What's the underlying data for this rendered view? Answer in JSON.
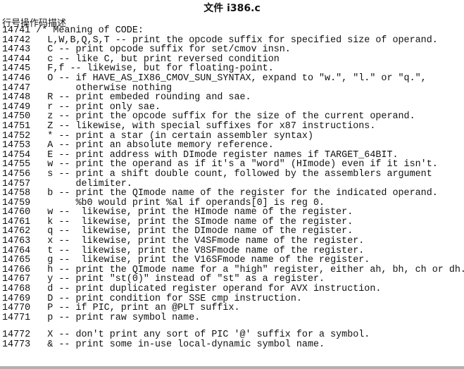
{
  "title": "文件 i386.c",
  "header": "行号操作码描述",
  "lines": [
    {
      "num": "14741",
      "text": "/* Meaning of CODE:"
    },
    {
      "num": "14742",
      "text": "  L,W,B,Q,S,T -- print the opcode suffix for specified size of operand."
    },
    {
      "num": "14743",
      "text": "  C -- print opcode suffix for set/cmov insn."
    },
    {
      "num": "14744",
      "text": "  c -- like C, but print reversed condition"
    },
    {
      "num": "14745",
      "text": "  F,f -- likewise, but for floating-point."
    },
    {
      "num": "14746",
      "text": "  O -- if HAVE_AS_IX86_CMOV_SUN_SYNTAX, expand to \"w.\", \"l.\" or \"q.\","
    },
    {
      "num": "14747",
      "text": "       otherwise nothing"
    },
    {
      "num": "14748",
      "text": "  R -- print embeded rounding and sae."
    },
    {
      "num": "14749",
      "text": "  r -- print only sae."
    },
    {
      "num": "14750",
      "text": "  z -- print the opcode suffix for the size of the current operand."
    },
    {
      "num": "14751",
      "text": "  Z -- likewise, with special suffixes for x87 instructions."
    },
    {
      "num": "14752",
      "text": "  * -- print a star (in certain assembler syntax)"
    },
    {
      "num": "14753",
      "text": "  A -- print an absolute memory reference."
    },
    {
      "num": "14754",
      "text": "  E -- print address with DImode register names if TARGET_64BIT."
    },
    {
      "num": "14755",
      "text": "  w -- print the operand as if it's a \"word\" (HImode) even if it isn't."
    },
    {
      "num": "14756",
      "text": "  s -- print a shift double count, followed by the assemblers argument"
    },
    {
      "num": "14757",
      "text": "       delimiter."
    },
    {
      "num": "14758",
      "text": "  b -- print the QImode name of the register for the indicated operand."
    },
    {
      "num": "14759",
      "text": "       %b0 would print %al if operands[0] is reg 0."
    },
    {
      "num": "14760",
      "text": "  w --  likewise, print the HImode name of the register."
    },
    {
      "num": "14761",
      "text": "  k --  likewise, print the SImode name of the register."
    },
    {
      "num": "14762",
      "text": "  q --  likewise, print the DImode name of the register."
    },
    {
      "num": "14763",
      "text": "  x --  likewise, print the V4SFmode name of the register."
    },
    {
      "num": "14764",
      "text": "  t --  likewise, print the V8SFmode name of the register."
    },
    {
      "num": "14765",
      "text": "  g --  likewise, print the V16SFmode name of the register."
    },
    {
      "num": "14766",
      "text": "  h -- print the QImode name for a \"high\" register, either ah, bh, ch or dh."
    },
    {
      "num": "14767",
      "text": "  y -- print \"st(0)\" instead of \"st\" as a register."
    },
    {
      "num": "14768",
      "text": "  d -- print duplicated register operand for AVX instruction."
    },
    {
      "num": "14769",
      "text": "  D -- print condition for SSE cmp instruction."
    },
    {
      "num": "14770",
      "text": "  P -- if PIC, print an @PLT suffix."
    },
    {
      "num": "14771",
      "text": "  p -- print raw symbol name."
    },
    {
      "num": "14772",
      "text": "  X -- don't print any sort of PIC '@' suffix for a symbol."
    },
    {
      "num": "14773",
      "text": "  & -- print some in-use local-dynamic symbol name."
    }
  ]
}
